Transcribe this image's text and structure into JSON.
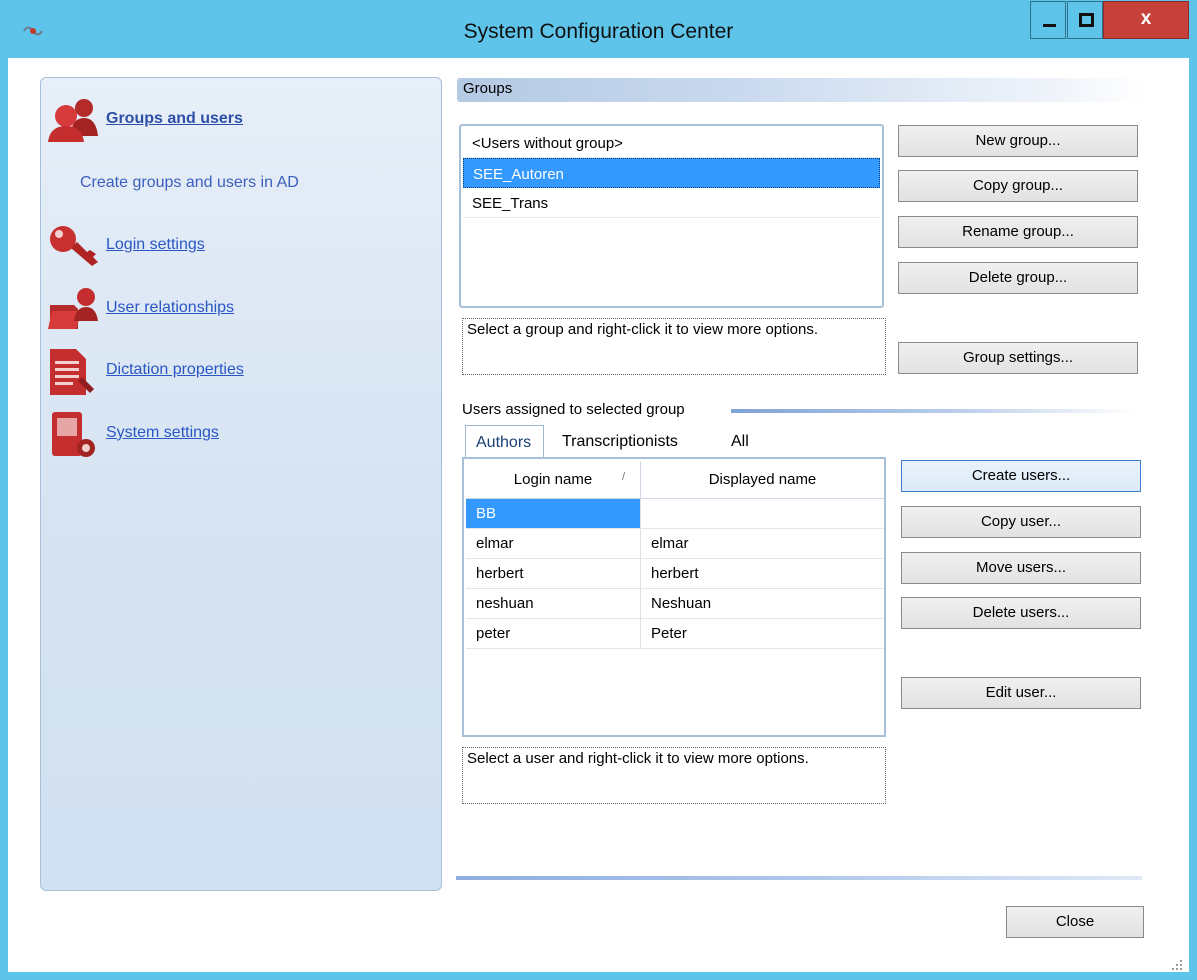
{
  "window": {
    "title": "System Configuration Center",
    "close_glyph": "x"
  },
  "nav": {
    "items": [
      {
        "label": "Groups and users",
        "icon": "group-users-icon",
        "active": true
      },
      {
        "label": "Login settings",
        "icon": "key-icon"
      },
      {
        "label": "User relationships",
        "icon": "user-relationships-icon"
      },
      {
        "label": "Dictation properties",
        "icon": "dictation-document-icon"
      },
      {
        "label": "System settings",
        "icon": "system-settings-icon"
      }
    ],
    "active_description": "Create groups and users in AD"
  },
  "groups": {
    "header": "Groups",
    "list": [
      "<Users without group>",
      "SEE_Autoren",
      "SEE_Trans"
    ],
    "selected_index": 1,
    "hint": "Select a group and right-click it to view more options.",
    "buttons": {
      "new": "New group...",
      "copy": "Copy group...",
      "rename": "Rename group...",
      "delete": "Delete group...",
      "settings": "Group settings..."
    }
  },
  "users": {
    "section_label": "Users assigned to selected group",
    "tabs": [
      "Authors",
      "Transcriptionists",
      "All"
    ],
    "active_tab": 0,
    "columns": [
      "Login name",
      "Displayed name"
    ],
    "sort_glyph": "/",
    "rows": [
      {
        "login": "BB",
        "display": ""
      },
      {
        "login": "elmar",
        "display": "elmar"
      },
      {
        "login": "herbert",
        "display": "herbert"
      },
      {
        "login": "neshuan",
        "display": "Neshuan"
      },
      {
        "login": "peter",
        "display": "Peter"
      }
    ],
    "selected_index": 0,
    "hint": "Select a user and right-click it to view more options.",
    "buttons": {
      "create": "Create users...",
      "copy": "Copy user...",
      "move": "Move users...",
      "delete": "Delete users...",
      "edit": "Edit user..."
    }
  },
  "footer": {
    "close": "Close"
  },
  "colors": {
    "titlebar": "#5ec4ea",
    "close_button": "#c7413b",
    "selection": "#3399ff",
    "link": "#2a56c6"
  }
}
